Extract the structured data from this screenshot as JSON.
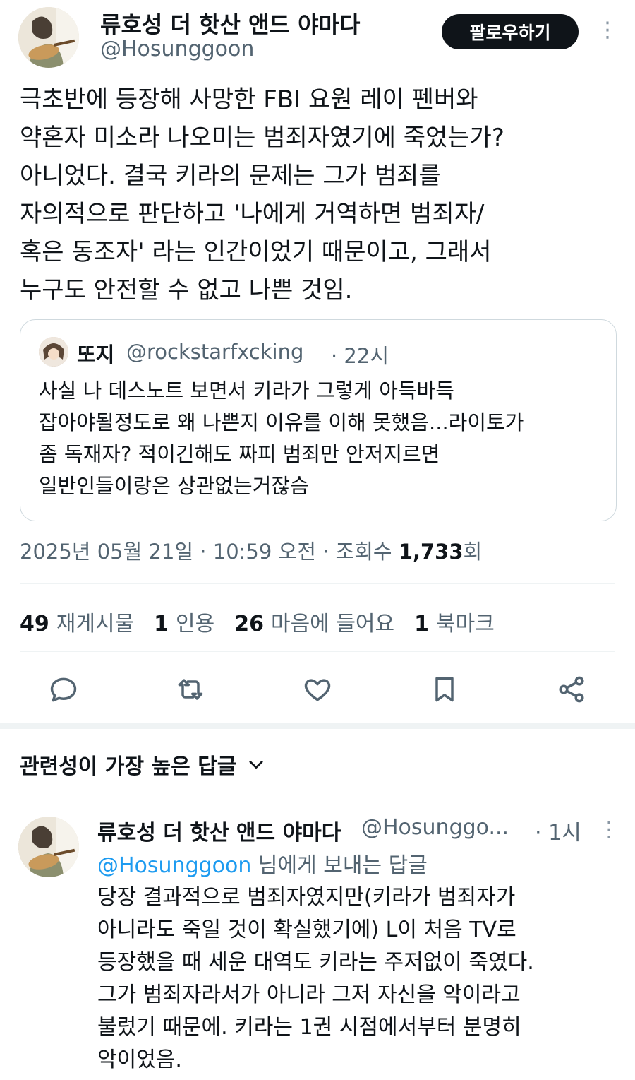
{
  "tweet": {
    "author_name": "류호성 더 핫산 앤드 야마다",
    "author_handle": "@Hosunggoon",
    "follow_label": "팔로우하기",
    "more_glyph": "⋮",
    "text": "극초반에 등장해 사망한 FBI 요원 레이 펜버와\n약혼자 미소라 나오미는 범죄자였기에 죽었는가?\n아니었다. 결국 키라의 문제는 그가 범죄를\n자의적으로 판단하고 '나에게 거역하면 범죄자/\n혹은 동조자' 라는 인간이었기 때문이고, 그래서\n누구도 안전할 수 없고 나쁜 것임.",
    "quote": {
      "author_name": "또지",
      "author_handle": "@rockstarfxcking",
      "time": "· 22시",
      "text": "사실 나 데스노트 보면서 키라가 그렇게 아득바득\n잡아야될정도로 왜 나쁜지 이유를 이해 못했음...라이토가\n좀 독재자? 적이긴해도 짜피 범죄만 안저지르면\n일반인들이랑은 상관없는거잖슴"
    },
    "timestamp": "2025년 05월 21일 · 10:59 오전 · 조회수",
    "views_count": "1,733",
    "views_suffix": "회",
    "stats": [
      {
        "count": "49",
        "label": "재게시물"
      },
      {
        "count": "1",
        "label": "인용"
      },
      {
        "count": "26",
        "label": "마음에 들어요"
      },
      {
        "count": "1",
        "label": "북마크"
      }
    ],
    "actions": [
      "reply-icon",
      "retweet-icon",
      "heart-icon",
      "bookmark-icon",
      "share-icon"
    ]
  },
  "replies_header": {
    "label": "관련성이 가장 높은 답글",
    "chevron": "chevron-down-icon"
  },
  "reply": {
    "author_name": "류호성 더 핫산 앤드 야마다",
    "author_handle": "@Hosunggo...",
    "time": "· 1시",
    "more_glyph": "⋮",
    "replying_to_handle": "@Hosunggoon",
    "replying_to_suffix": " 님에게 보내는 답글",
    "text": "당장 결과적으로 범죄자였지만(키라가 범죄자가\n아니라도 죽일 것이 확실했기에) L이 처음 TV로\n등장했을 때 세운 대역도 키라는 주저없이 죽였다.\n그가 범죄자라서가 아니라 그저 자신을 악이라고\n불렀기 때문에. 키라는 1권 시점에서부터 분명히\n악이었음."
  },
  "colors": {
    "text_primary": "#0f1419",
    "text_secondary": "#536471",
    "link": "#1d9bf0",
    "border": "#cfd9de"
  }
}
